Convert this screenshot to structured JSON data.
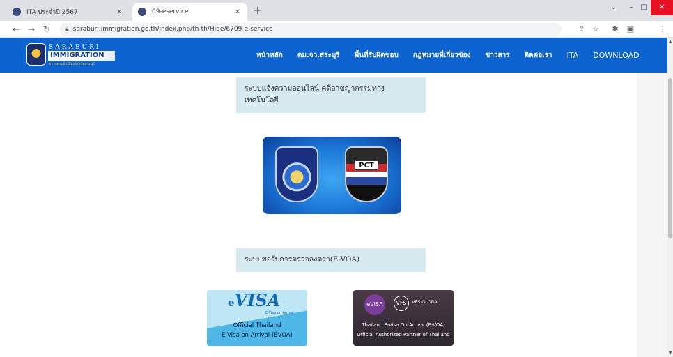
{
  "browser": {
    "tabs": [
      {
        "label": "ITA ประจำปี 2567",
        "active": false
      },
      {
        "label": "09-eservice",
        "active": true
      }
    ],
    "new_tab": "+",
    "url": "saraburi.immigration.go.th/index.php/th-th/Hide/6709-e-service",
    "window_controls": {
      "down": "⌄",
      "minimize": "–",
      "maximize": "□",
      "close": "✕"
    }
  },
  "site": {
    "logo": {
      "line1": "SARABURI",
      "line2": "IMMIGRATION",
      "line3": "ตรวจคนเข้าเมืองจังหวัดสระบุรี"
    },
    "menu": [
      "หน้าหลัก",
      "ตม.จว.สระบุรี",
      "พื้นที่รับผิดชอบ",
      "กฎหมายที่เกี่ยวข้อง",
      "ข่าวสาร",
      "ติดต่อเรา",
      "ITA",
      "DOWNLOAD"
    ]
  },
  "content": {
    "section1_title": "ระบบแจ้งความออนไลน์ คดีอาชญากรรมทาง เทคโนโลยี",
    "police_banner": {
      "badge_text": "PCT"
    },
    "section2_title": "ระบบขอรับการตรวจลงตรา(E-VOA)",
    "evisa_left": {
      "mark": "VISA",
      "mark_prefix": "e",
      "arrival": "E-Visa on Arrival",
      "line1": "Official Thailand",
      "line2": "E-Visa on Arrival (EVOA)"
    },
    "evisa_right": {
      "badge": "eVISA",
      "badge2": "VFS",
      "brand": "VFS.GLOBAL",
      "line1": "Thailand E-Visa On Arrival (E-VOA)",
      "line2": "Official Authorized Partner of Thailand"
    }
  },
  "colors": {
    "nav_blue": "#0d63d0",
    "box_bg": "#d6eaf0",
    "close_red": "#e81123"
  },
  "icons": [
    "back-arrow-icon",
    "forward-arrow-icon",
    "reload-icon",
    "lock-icon",
    "share-icon",
    "star-icon",
    "extensions-icon",
    "sidepanel-icon",
    "kebab-menu-icon"
  ]
}
